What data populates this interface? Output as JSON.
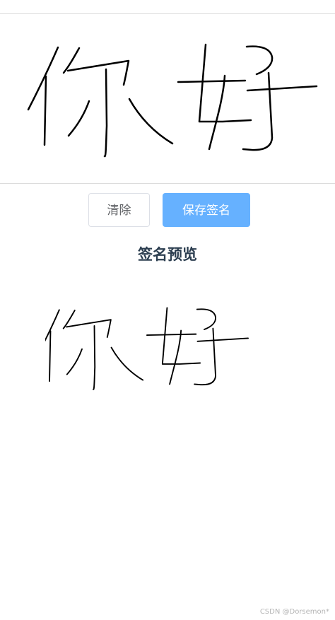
{
  "signature_pad": {
    "stroke_color": "#000000",
    "background_color": "#ffffff"
  },
  "buttons": {
    "clear_label": "清除",
    "save_label": "保存签名",
    "save_color": "#66b1ff"
  },
  "preview": {
    "title": "签名预览"
  },
  "watermark": {
    "text": "CSDN @Dorsemon*"
  }
}
